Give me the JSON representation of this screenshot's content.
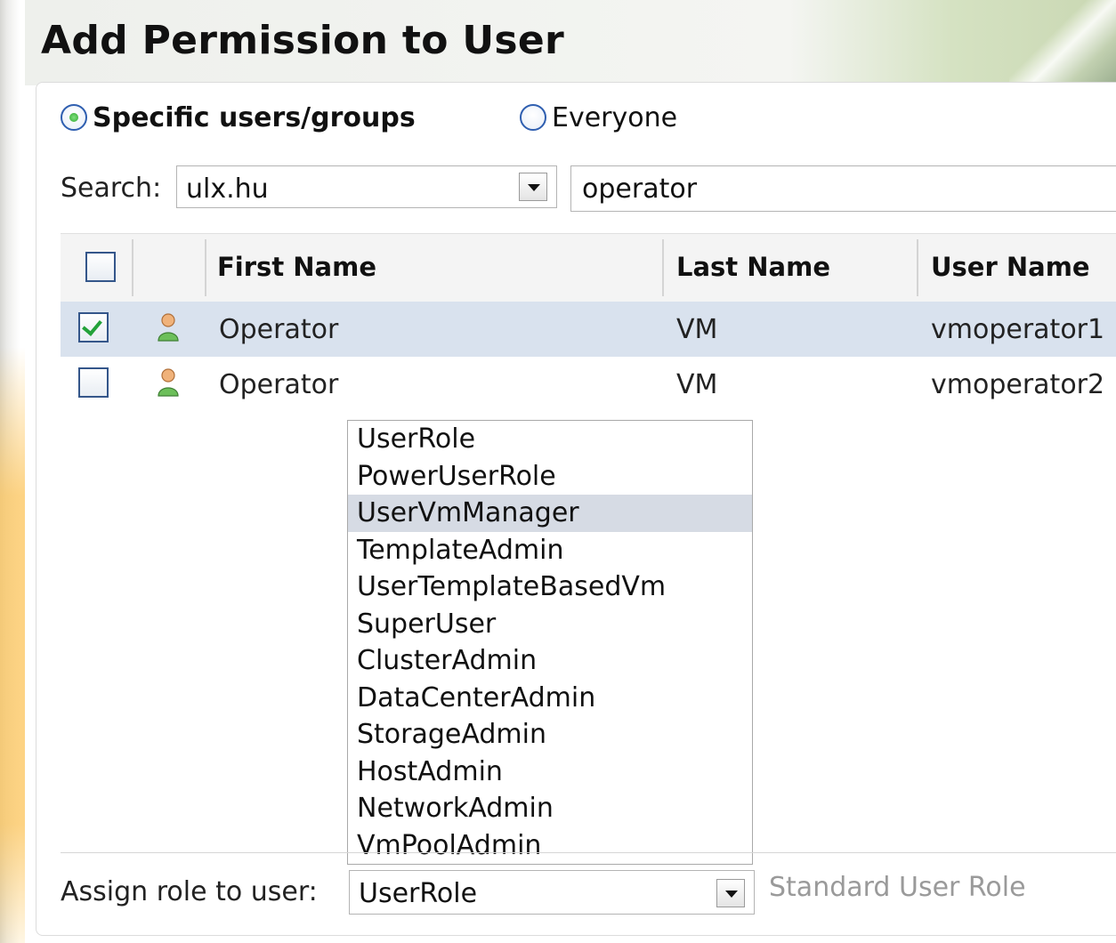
{
  "dialog": {
    "title": "Add Permission to User"
  },
  "scope": {
    "options": [
      {
        "label": "Specific users/groups",
        "selected": true
      },
      {
        "label": "Everyone",
        "selected": false
      }
    ]
  },
  "search": {
    "label": "Search:",
    "domain_value": "ulx.hu",
    "query_value": "operator"
  },
  "table": {
    "columns": [
      "First Name",
      "Last Name",
      "User Name"
    ],
    "rows": [
      {
        "checked": true,
        "first_name": "Operator",
        "last_name": "VM",
        "user_name": "vmoperator1"
      },
      {
        "checked": false,
        "first_name": "Operator",
        "last_name": "VM",
        "user_name": "vmoperator2"
      }
    ]
  },
  "role_dropdown": {
    "options": [
      "UserRole",
      "PowerUserRole",
      "UserVmManager",
      "TemplateAdmin",
      "UserTemplateBasedVm",
      "SuperUser",
      "ClusterAdmin",
      "DataCenterAdmin",
      "StorageAdmin",
      "HostAdmin",
      "NetworkAdmin",
      "VmPoolAdmin"
    ],
    "highlighted": "UserVmManager"
  },
  "assign": {
    "label": "Assign role to user:",
    "value": "UserRole",
    "description": "Standard User Role"
  },
  "colors": {
    "selected_row": "#d9e2ee",
    "highlight_item": "#d6dbe4",
    "checkmark": "#23a23a"
  }
}
